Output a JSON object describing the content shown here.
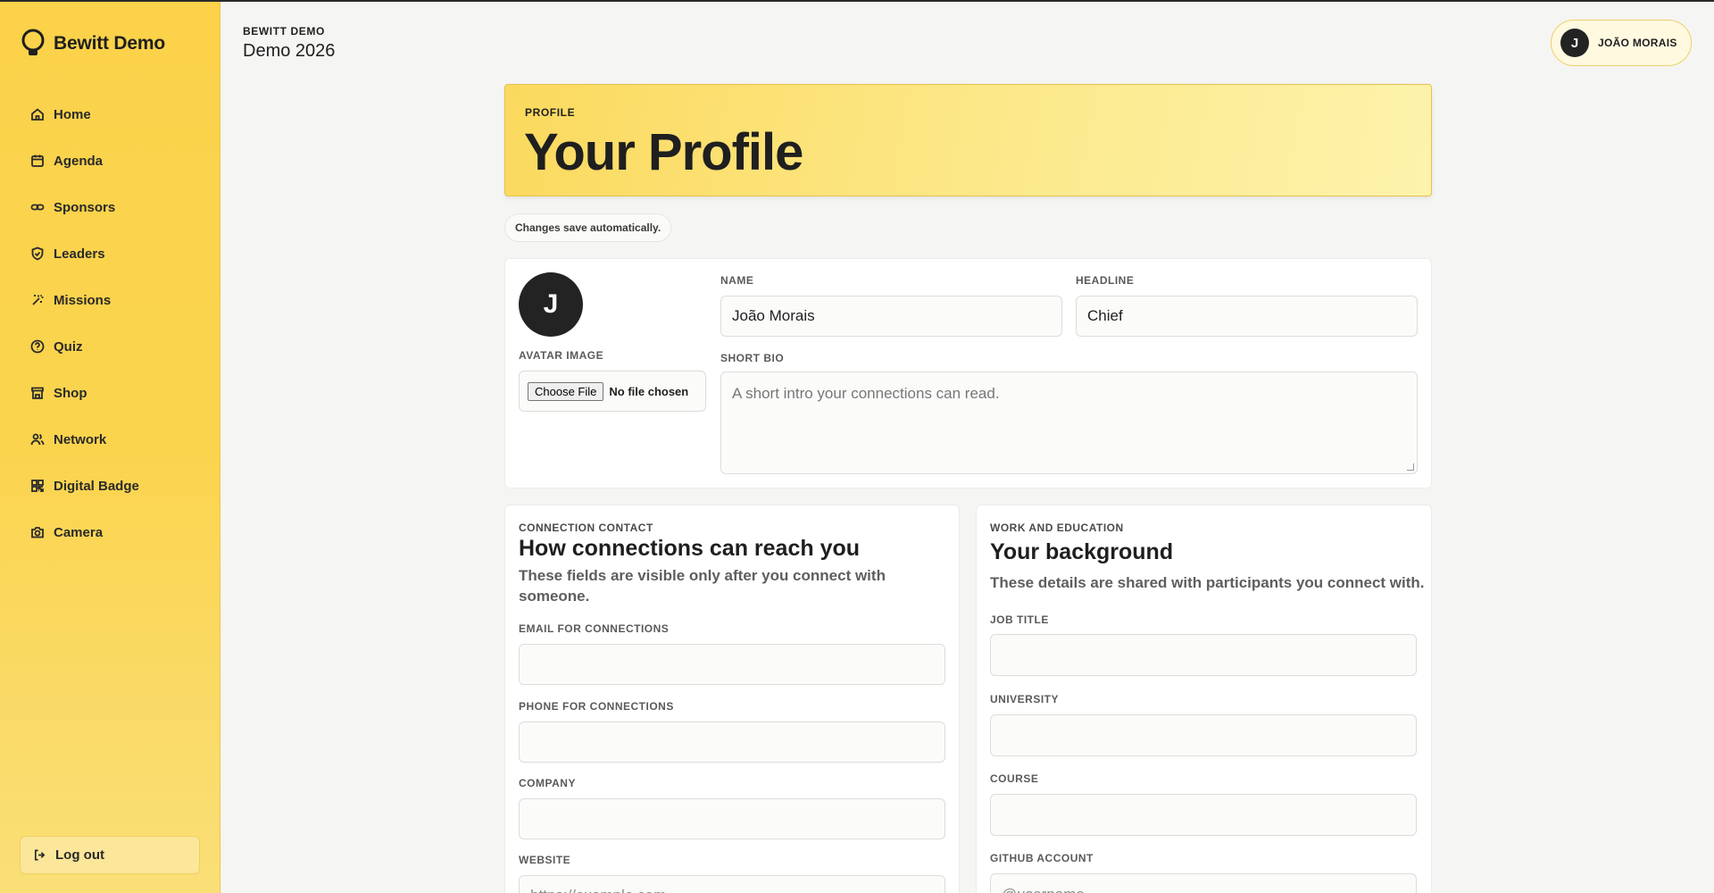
{
  "brand": {
    "name": "Bewitt Demo",
    "icon": "lightbulb-icon"
  },
  "sidebar": {
    "items": [
      {
        "label": "Home",
        "icon": "home-icon"
      },
      {
        "label": "Agenda",
        "icon": "calendar-icon"
      },
      {
        "label": "Sponsors",
        "icon": "link-icon"
      },
      {
        "label": "Leaders",
        "icon": "shield-icon"
      },
      {
        "label": "Missions",
        "icon": "sparkle-icon"
      },
      {
        "label": "Quiz",
        "icon": "help-circle-icon"
      },
      {
        "label": "Shop",
        "icon": "store-icon"
      },
      {
        "label": "Network",
        "icon": "users-icon"
      },
      {
        "label": "Digital Badge",
        "icon": "qr-icon"
      },
      {
        "label": "Camera",
        "icon": "camera-icon"
      }
    ],
    "logout_label": "Log out"
  },
  "header": {
    "kicker": "BEWITT DEMO",
    "title": "Demo 2026",
    "user_initial": "J",
    "user_name": "JOÃO MORAIS"
  },
  "hero": {
    "kicker": "PROFILE",
    "title": "Your Profile"
  },
  "autosave_text": "Changes save automatically.",
  "profile": {
    "avatar_initial": "J",
    "avatar_label": "AVATAR IMAGE",
    "file_button": "Choose File",
    "file_status": "No file chosen",
    "name_label": "NAME",
    "name_value": "João Morais",
    "headline_label": "HEADLINE",
    "headline_value": "Chief",
    "bio_label": "SHORT BIO",
    "bio_placeholder": "A short intro your connections can read."
  },
  "contact": {
    "kicker": "CONNECTION CONTACT",
    "title": "How connections can reach you",
    "desc": "These fields are visible only after you connect with someone.",
    "email_label": "EMAIL FOR CONNECTIONS",
    "phone_label": "PHONE FOR CONNECTIONS",
    "company_label": "COMPANY",
    "website_label": "WEBSITE",
    "website_placeholder": "https://example.com"
  },
  "background": {
    "kicker": "WORK AND EDUCATION",
    "title": "Your background",
    "desc": "These details are shared with participants you connect with.",
    "job_label": "JOB TITLE",
    "university_label": "UNIVERSITY",
    "course_label": "COURSE",
    "github_label": "GITHUB ACCOUNT",
    "github_placeholder": "@username"
  }
}
